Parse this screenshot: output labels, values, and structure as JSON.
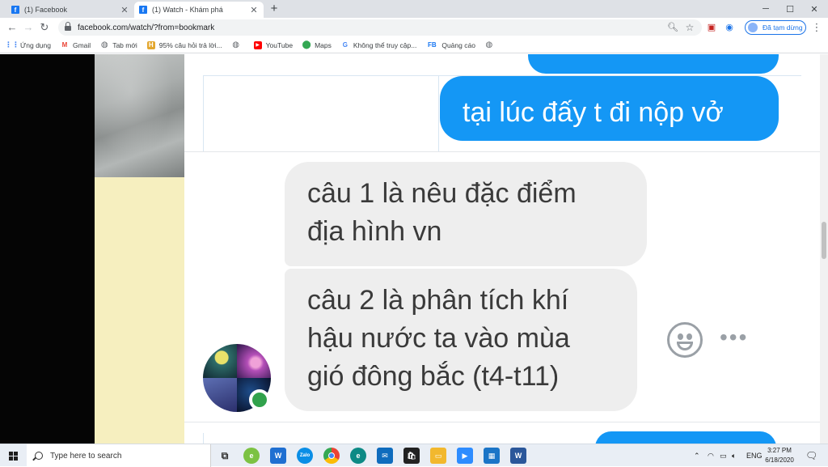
{
  "browser": {
    "tabs": [
      {
        "title": "(1) Facebook",
        "active": false
      },
      {
        "title": "(1) Watch - Khám phá",
        "active": true
      }
    ],
    "address": "facebook.com/watch/?from=bookmark",
    "profile_status": "Đã tạm dừng",
    "bookmarks": [
      {
        "label": "Ứng dụng",
        "icon": "apps-grid-icon"
      },
      {
        "label": "Gmail",
        "icon": "gmail-icon"
      },
      {
        "label": "Tab mới",
        "icon": "globe-icon"
      },
      {
        "label": "95% câu hỏi trả lời...",
        "icon": "hoidap-icon"
      },
      {
        "label": "",
        "icon": "globe-icon"
      },
      {
        "label": "YouTube",
        "icon": "youtube-icon"
      },
      {
        "label": "Maps",
        "icon": "maps-pin-icon"
      },
      {
        "label": "Không thể truy cập...",
        "icon": "google-icon"
      },
      {
        "label": "Quảng cáo",
        "icon": "fb-text-icon"
      },
      {
        "label": "",
        "icon": "globe-icon"
      }
    ]
  },
  "chat": {
    "messages": [
      {
        "direction": "outgoing",
        "text": "tại lúc đấy t đi nộp vở"
      },
      {
        "direction": "incoming",
        "text_lines": [
          "câu 1 là nêu đặc điểm",
          "địa hình vn"
        ]
      },
      {
        "direction": "incoming",
        "text_lines": [
          "câu 2 là phân tích khí",
          "hậu nước ta vào mùa",
          "gió đông bắc (t4-t11)"
        ]
      }
    ],
    "colors": {
      "outgoing_bubble": "#1497f5",
      "incoming_bubble": "#eeeeee",
      "online_dot": "#31a24c"
    }
  },
  "taskbar": {
    "search_placeholder": "Type here to search",
    "language": "ENG",
    "time": "3:27 PM",
    "date": "6/18/2020",
    "apps": [
      "task-view-icon",
      "green-app-icon",
      "shield-app-icon",
      "zalo-icon",
      "chrome-icon",
      "edge-icon",
      "mail-icon",
      "store-icon",
      "file-explorer-icon",
      "zoom-icon",
      "photos-icon",
      "word-icon"
    ]
  }
}
